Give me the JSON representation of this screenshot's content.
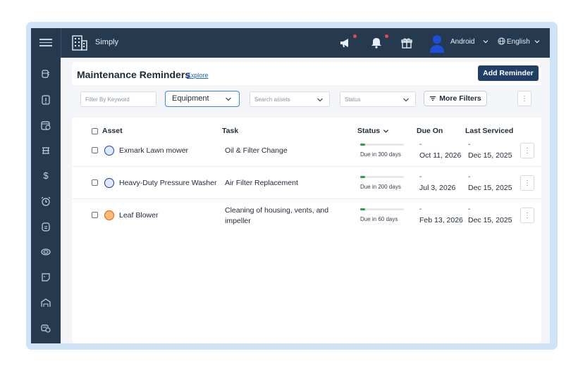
{
  "topbar": {
    "app_name": "Simply",
    "user_name": "Android",
    "language": "English",
    "icons": [
      "menu-icon",
      "building-logo-icon",
      "megaphone-icon",
      "bell-icon",
      "gift-icon",
      "user-avatar-icon",
      "globe-icon"
    ],
    "notification_dot_color": "#ef4444"
  },
  "sidebar": {
    "items": [
      "assets-icon",
      "work-orders-icon",
      "calendar-icon",
      "inventory-icon",
      "dollar-icon",
      "alarm-icon",
      "requests-icon",
      "meters-icon",
      "documents-icon",
      "locations-icon",
      "vendors-icon"
    ]
  },
  "page": {
    "title": "Maintenance Reminders",
    "explore": "Explore",
    "add_button": "Add Reminder"
  },
  "filters": {
    "keyword_placeholder": "Filter By Keyword",
    "category_value": "Equipment",
    "assets_placeholder": "Search assets",
    "status_placeholder": "Status",
    "more_filters": "More Filters",
    "kebab": "⋮"
  },
  "table": {
    "headers": {
      "asset": "Asset",
      "task": "Task",
      "status": "Status",
      "due_on": "Due On",
      "last_serviced": "Last Serviced"
    },
    "rows": [
      {
        "asset": "Exmark Lawn mower",
        "task": "Oil & Filter Change",
        "task_line2": "",
        "status": "Due in 300 days",
        "progress": 0.12,
        "due_dash": "-",
        "due_on": "Oct 11, 2026",
        "last_dash": "-",
        "last_serviced": "Dec 15, 2025",
        "icon": "lawn-mower-icon",
        "icon_color": "#1e40af"
      },
      {
        "asset": "Heavy-Duty Pressure Washer",
        "task": "Air Filter Replacement",
        "task_line2": "",
        "status": "Due in 200 days",
        "progress": 0.12,
        "due_dash": "-",
        "due_on": "Jul 3, 2026",
        "last_dash": "-",
        "last_serviced": "Dec 15, 2025",
        "icon": "pressure-washer-icon",
        "icon_color": "#1e3a8a"
      },
      {
        "asset": "Leaf Blower",
        "task": "Cleaning of housing, vents, and",
        "task_line2": "impeller",
        "status": "Due in 60 days",
        "progress": 0.12,
        "due_dash": "-",
        "due_on": "Feb 13, 2026",
        "last_dash": "-",
        "last_serviced": "Dec 15, 2025",
        "icon": "leaf-blower-icon",
        "icon_color": "#ea580c"
      }
    ]
  }
}
